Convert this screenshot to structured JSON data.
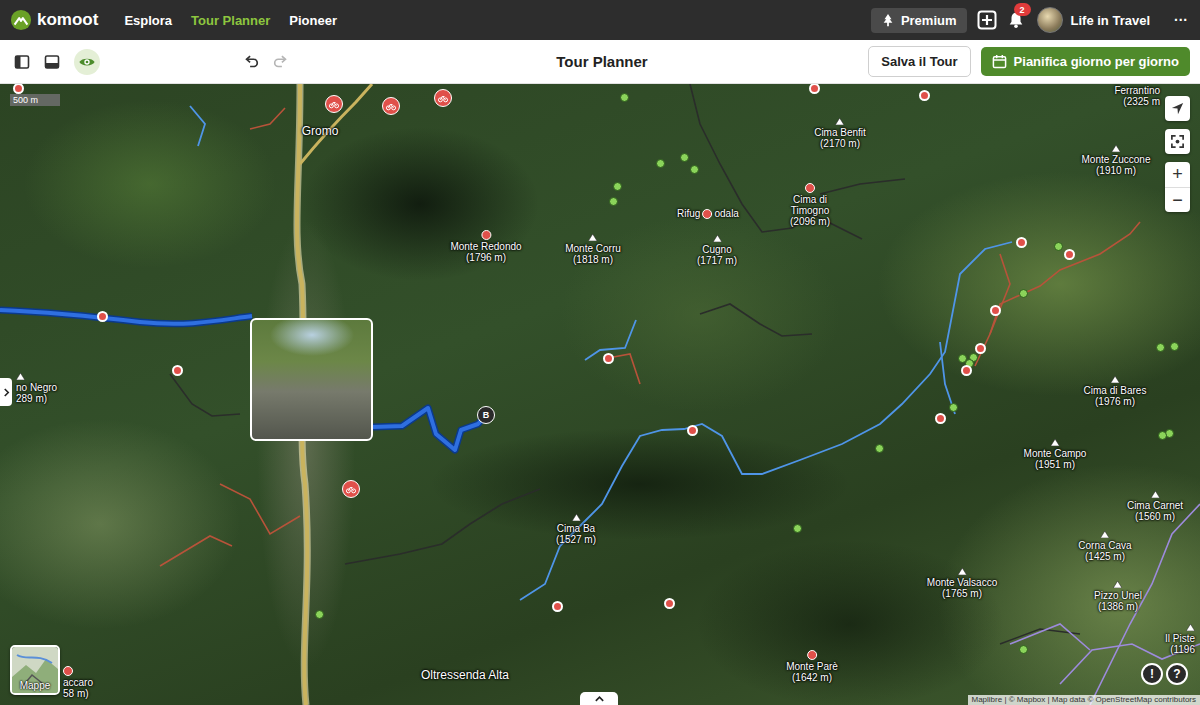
{
  "topbar": {
    "logo": "komoot",
    "nav": [
      {
        "label": "Esplora",
        "selected": false
      },
      {
        "label": "Tour Planner",
        "selected": true
      },
      {
        "label": "Pioneer",
        "selected": false
      }
    ],
    "premium": "Premium",
    "notifications": "2",
    "user": "Life in Travel",
    "more": "···"
  },
  "toolbar": {
    "title": "Tour Planner",
    "visibility_on": true,
    "undo_enabled": true,
    "redo_enabled": false,
    "save": "Salva il Tour",
    "plan": "Pianifica giorno per giorno"
  },
  "map": {
    "scale": "500 m",
    "route_end": "B",
    "layers_button": "Mappe",
    "zoom_in": "+",
    "zoom_out": "−",
    "feedback": "!",
    "help": "?",
    "attribution": "Maplibre | © Mapbox | Map data © OpenStreetMap contributors",
    "places": [
      {
        "kind": "town",
        "name": "Gromo"
      },
      {
        "kind": "peak",
        "name": "Cima Benfit",
        "elevation": "(2170 m)"
      },
      {
        "kind": "peak",
        "name": "Ferrantino",
        "elevation": "(2325 m"
      },
      {
        "kind": "peak",
        "name": "Monte Zuccone",
        "elevation": "(1910 m)"
      },
      {
        "kind": "peak",
        "name": "Cima di Timogno",
        "elevation": "(2096 m)"
      },
      {
        "kind": "hut",
        "name": "Rifug",
        "name_after_icon": "odala"
      },
      {
        "kind": "peak",
        "name": "Cugno",
        "elevation": "(1717 m)"
      },
      {
        "kind": "peak",
        "name": "Monte Redondo",
        "elevation": "(1796 m)"
      },
      {
        "kind": "peak",
        "name": "Monte Corru",
        "elevation": "(1818 m)"
      },
      {
        "kind": "peak",
        "name": "Cima di Bares",
        "elevation": "(1976 m)"
      },
      {
        "kind": "peak",
        "name": "Monte Campo",
        "elevation": "(1951 m)"
      },
      {
        "kind": "peak",
        "name": "Cima Carnet",
        "elevation": "(1560 m)"
      },
      {
        "kind": "peak",
        "name": "Corna Cava",
        "elevation": "(1425 m)"
      },
      {
        "kind": "peak",
        "name": "Pizzo Unel",
        "elevation": "(1386 m)"
      },
      {
        "kind": "peak",
        "name": "Il Piste",
        "elevation": "(1196"
      },
      {
        "kind": "peak",
        "name": "Monte Valsacco",
        "elevation": "(1765 m)"
      },
      {
        "kind": "peak",
        "name": "Monte Parè",
        "elevation": "(1642 m)"
      },
      {
        "kind": "peak",
        "name": "Cima Ba",
        "elevation": "(1527 m)"
      },
      {
        "kind": "town",
        "name": "Oltressenda Alta"
      },
      {
        "kind": "peak",
        "name": "no Negro",
        "elevation": "289 m)"
      },
      {
        "kind": "peak",
        "name": "accaro",
        "elevation": "58 m)"
      }
    ]
  }
}
